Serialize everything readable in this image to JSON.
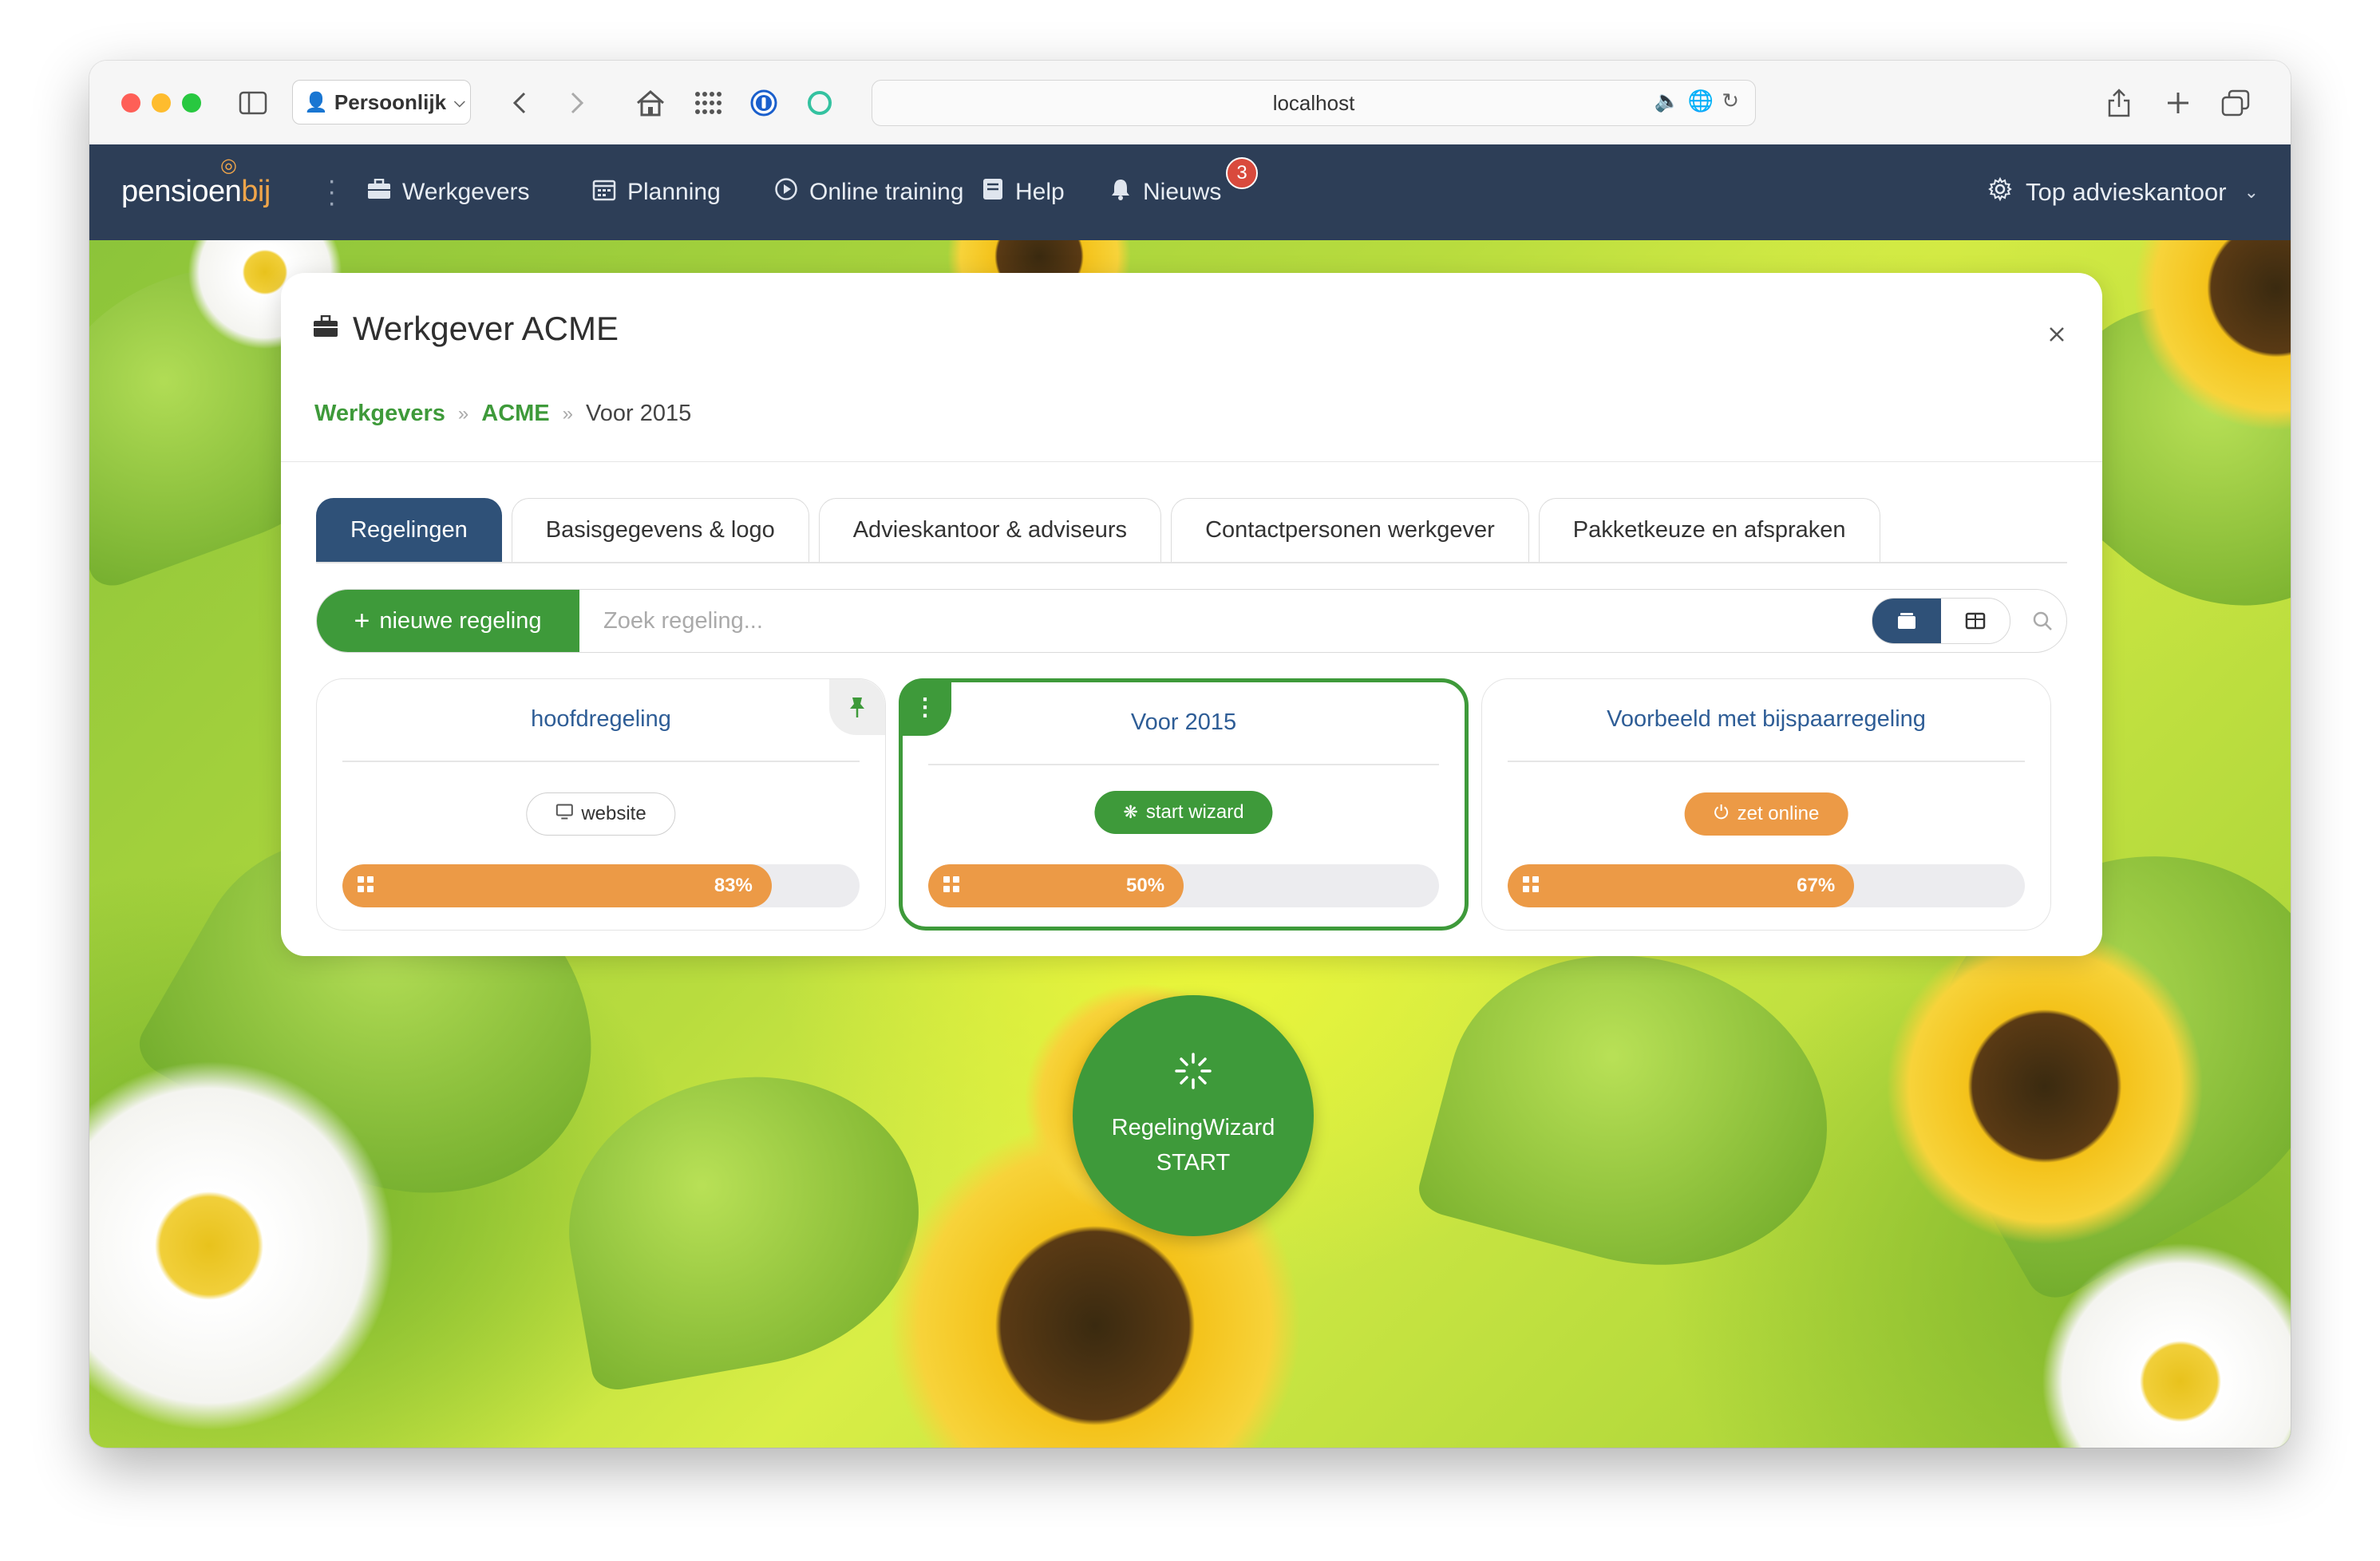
{
  "browser": {
    "profile_label": "Persoonlijk",
    "url": "localhost"
  },
  "navbar": {
    "logo_text_main": "pensioen",
    "logo_text_accent": "bij",
    "items": [
      {
        "label": "Werkgevers",
        "icon": "briefcase-icon"
      },
      {
        "label": "Planning",
        "icon": "calendar-icon"
      },
      {
        "label": "Online training",
        "icon": "play-icon"
      },
      {
        "label": "Help",
        "icon": "book-icon"
      },
      {
        "label": "Nieuws",
        "icon": "bell-icon"
      }
    ],
    "news_badge": "3",
    "office_label": "Top advieskantoor"
  },
  "panel": {
    "title": "Werkgever ACME",
    "breadcrumb": [
      "Werkgevers",
      "ACME",
      "Voor 2015"
    ],
    "tabs": [
      {
        "label": "Regelingen",
        "active": true
      },
      {
        "label": "Basisgegevens & logo",
        "active": false
      },
      {
        "label": "Advieskantoor & adviseurs",
        "active": false
      },
      {
        "label": "Contactpersonen werkgever",
        "active": false
      },
      {
        "label": "Pakketkeuze en afspraken",
        "active": false
      }
    ],
    "toolbar": {
      "new_button_label": "nieuwe regeling",
      "search_placeholder": "Zoek regeling..."
    },
    "cards": [
      {
        "title": "hoofdregeling",
        "action_label": "website",
        "action_style": "outline",
        "progress": 83,
        "progress_label": "83%",
        "pinned": true,
        "selected": false
      },
      {
        "title": "Voor 2015",
        "action_label": "start wizard",
        "action_style": "green",
        "progress": 50,
        "progress_label": "50%",
        "pinned": false,
        "selected": true
      },
      {
        "title": "Voorbeeld met bijspaarregeling",
        "action_label": "zet online",
        "action_style": "orange",
        "progress": 67,
        "progress_label": "67%",
        "pinned": false,
        "selected": false
      }
    ]
  },
  "wizard": {
    "line1": "RegelingWizard",
    "line2": "START"
  },
  "colors": {
    "navbar": "#2d3e57",
    "accent_green": "#3e9a3a",
    "accent_orange": "#ec9a46",
    "tab_active": "#2f5178",
    "link_blue": "#2e5d96"
  }
}
